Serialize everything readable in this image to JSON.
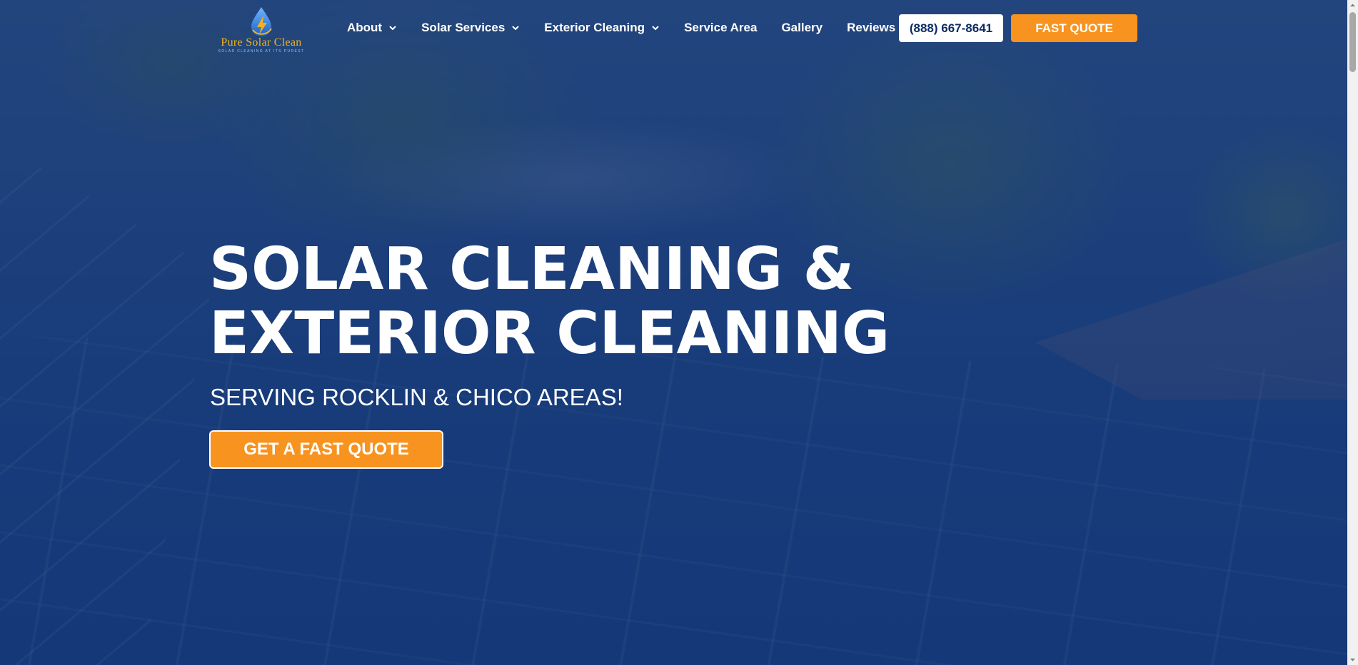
{
  "brand": {
    "logo_title": "Pure Solar Clean",
    "logo_tagline": "SOLAR CLEANING AT ITS PUREST",
    "primary_color": "#0c2b63",
    "accent_color": "#f7931e",
    "logo_gold": "#f3b21c",
    "logo_icon": "water-drop-lightning-icon"
  },
  "nav": {
    "items": [
      {
        "label": "About",
        "has_dropdown": true
      },
      {
        "label": "Solar Services",
        "has_dropdown": true
      },
      {
        "label": "Exterior Cleaning",
        "has_dropdown": true
      },
      {
        "label": "Service Area",
        "has_dropdown": false
      },
      {
        "label": "Gallery",
        "has_dropdown": false
      },
      {
        "label": "Reviews",
        "has_dropdown": false
      }
    ],
    "phone_label": "(888) 667-8641",
    "quote_label": "FAST QUOTE"
  },
  "hero": {
    "headline_line1": "SOLAR CLEANING &",
    "headline_line2": "EXTERIOR CLEANING",
    "subheadline": "SERVING ROCKLIN & CHICO AREAS!",
    "cta_label": "GET A FAST QUOTE"
  }
}
